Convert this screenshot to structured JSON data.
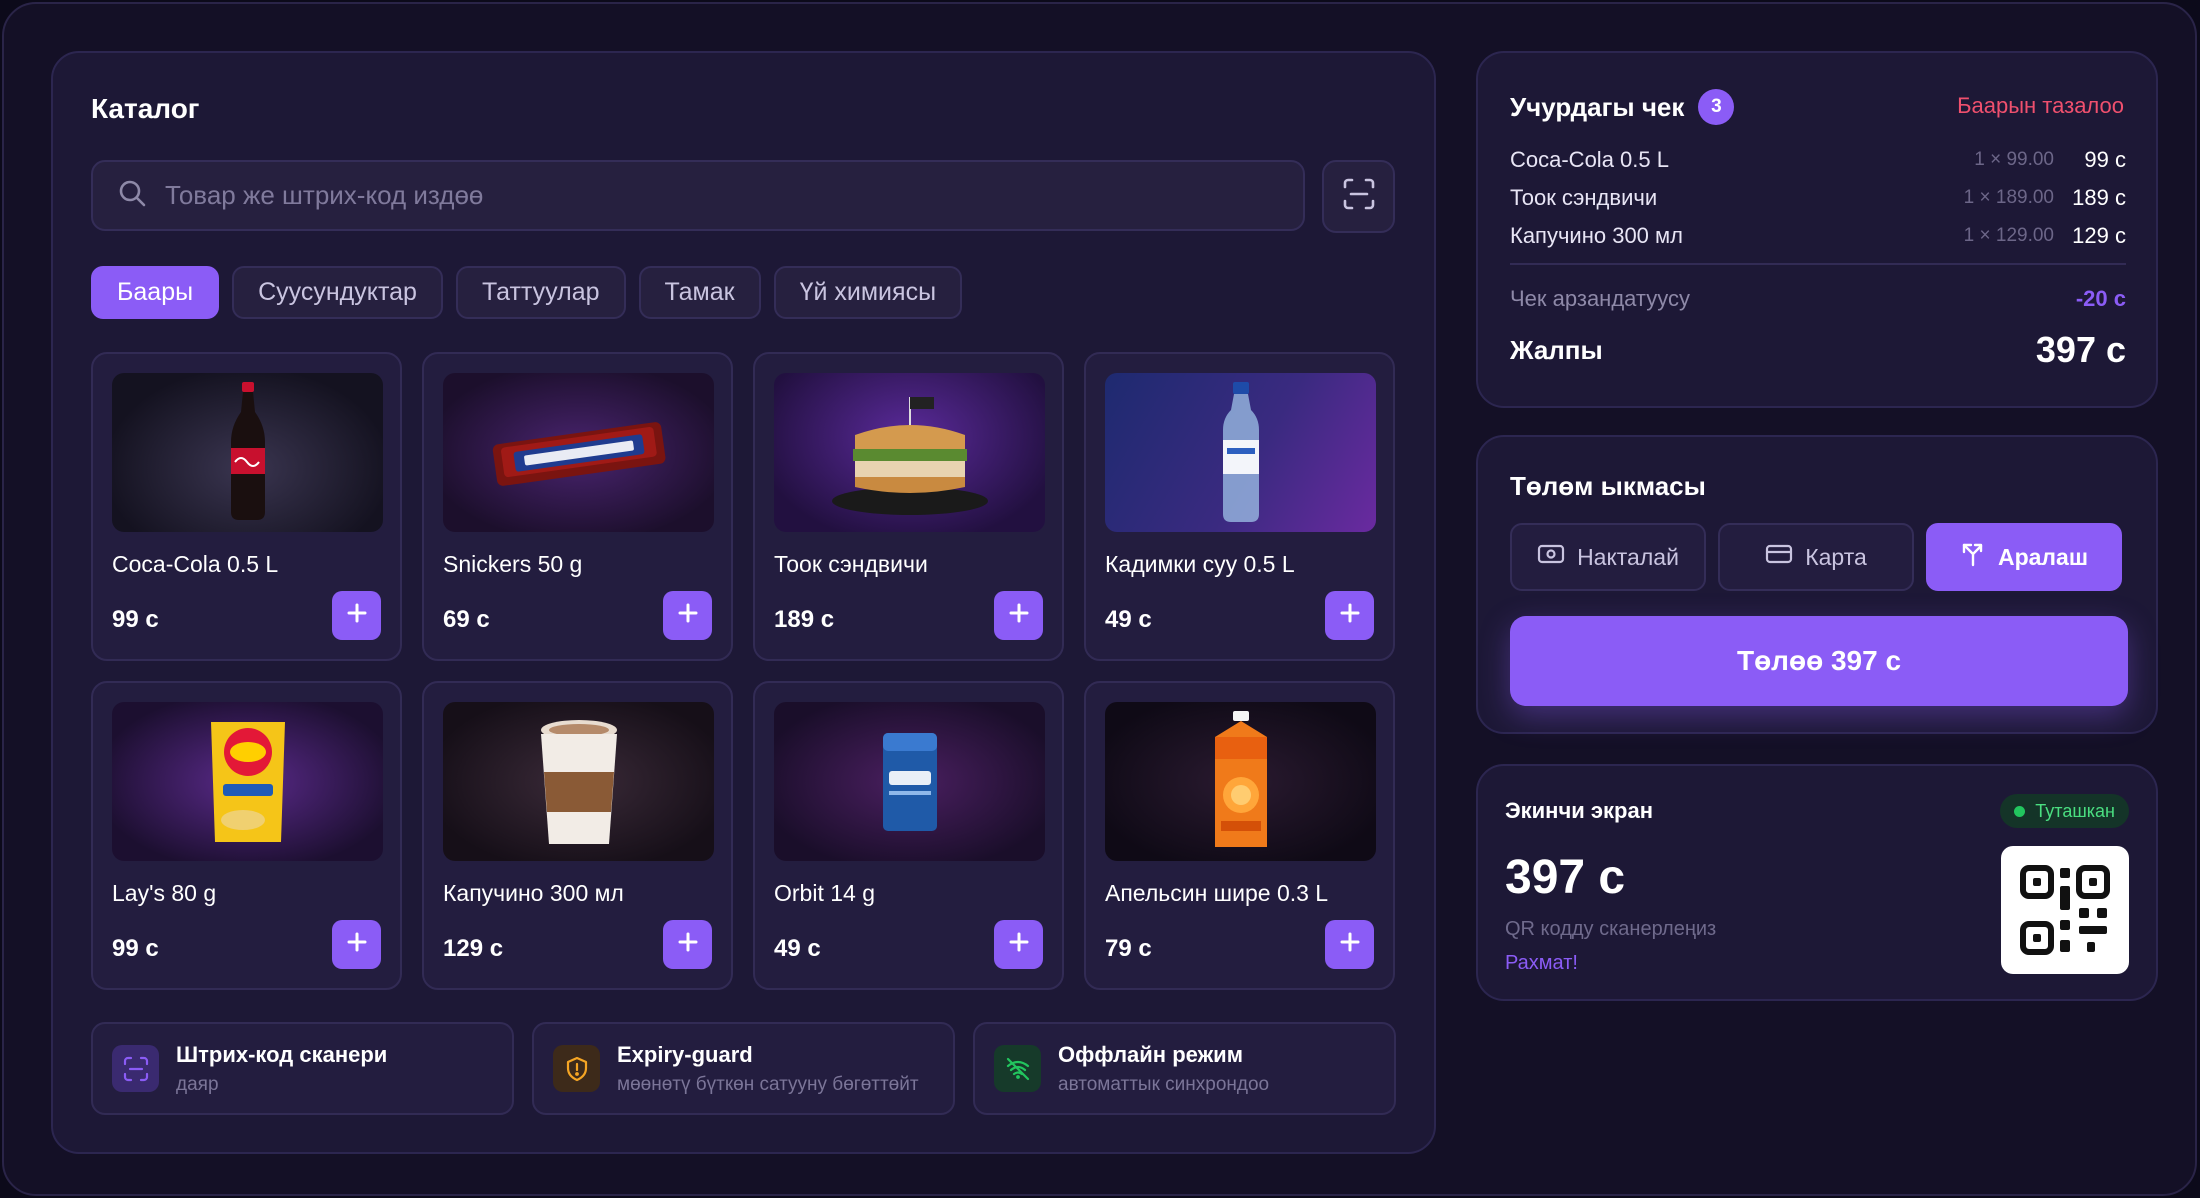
{
  "catalog": {
    "title": "Каталог",
    "search_placeholder": "Товар же штрих-код издөө",
    "search_value": "",
    "categories": [
      {
        "label": "Баары",
        "active": true
      },
      {
        "label": "Суусундуктар",
        "active": false
      },
      {
        "label": "Таттуулар",
        "active": false
      },
      {
        "label": "Тамак",
        "active": false
      },
      {
        "label": "Үй химиясы",
        "active": false
      }
    ],
    "products": [
      {
        "name": "Coca-Cola 0.5 L",
        "price": "99 с",
        "icon": "cola-bottle"
      },
      {
        "name": "Snickers 50 g",
        "price": "69 с",
        "icon": "chocolate-bar"
      },
      {
        "name": "Тоок сэндвичи",
        "price": "189 с",
        "icon": "sandwich"
      },
      {
        "name": "Кадимки суу 0.5 L",
        "price": "49 с",
        "icon": "water-bottle"
      },
      {
        "name": "Lay's 80 g",
        "price": "99 с",
        "icon": "chips-bag"
      },
      {
        "name": "Капучино 300 мл",
        "price": "129 с",
        "icon": "coffee-cup"
      },
      {
        "name": "Orbit 14 g",
        "price": "49 с",
        "icon": "gum-pack"
      },
      {
        "name": "Апельсин шире 0.3 L",
        "price": "79 с",
        "icon": "juice-carton"
      }
    ],
    "features": [
      {
        "title": "Штрих-код сканери",
        "subtitle": "даяр",
        "icon": "barcode-scan-icon"
      },
      {
        "title": "Expiry-guard",
        "subtitle": "мөөнөтү бүткөн сатууну бөгөттөйт",
        "icon": "shield-alert-icon"
      },
      {
        "title": "Оффлайн режим",
        "subtitle": "автоматтык синхрондоо",
        "icon": "wifi-off-icon"
      }
    ]
  },
  "receipt": {
    "title": "Учурдагы чек",
    "count": "3",
    "clear_label": "Баарын тазалоо",
    "items": [
      {
        "name": "Coca-Cola 0.5 L",
        "qty": "1 × 99.00",
        "total": "99 с"
      },
      {
        "name": "Тоок сэндвичи",
        "qty": "1 × 189.00",
        "total": "189 с"
      },
      {
        "name": "Капучино 300 мл",
        "qty": "1 × 129.00",
        "total": "129 с"
      }
    ],
    "discount_label": "Чек арзандатуусу",
    "discount_value": "-20 с",
    "total_label": "Жалпы",
    "total_value": "397 с"
  },
  "payment": {
    "title": "Төлөм ыкмасы",
    "methods": [
      {
        "label": "Накталай",
        "icon": "cash-icon",
        "active": false
      },
      {
        "label": "Карта",
        "icon": "card-icon",
        "active": false
      },
      {
        "label": "Аралаш",
        "icon": "split-icon",
        "active": true
      }
    ],
    "pay_label": "Төлөө 397 с"
  },
  "second_screen": {
    "title": "Экинчи экран",
    "status": "Туташкан",
    "amount": "397 с",
    "hint": "QR кодду сканерлеңиз",
    "thanks": "Рахмат!"
  },
  "colors": {
    "accent": "#8b5cf6",
    "danger": "#f0506e",
    "success": "#22c55e",
    "background": "#141026",
    "panel": "#1d1836"
  }
}
